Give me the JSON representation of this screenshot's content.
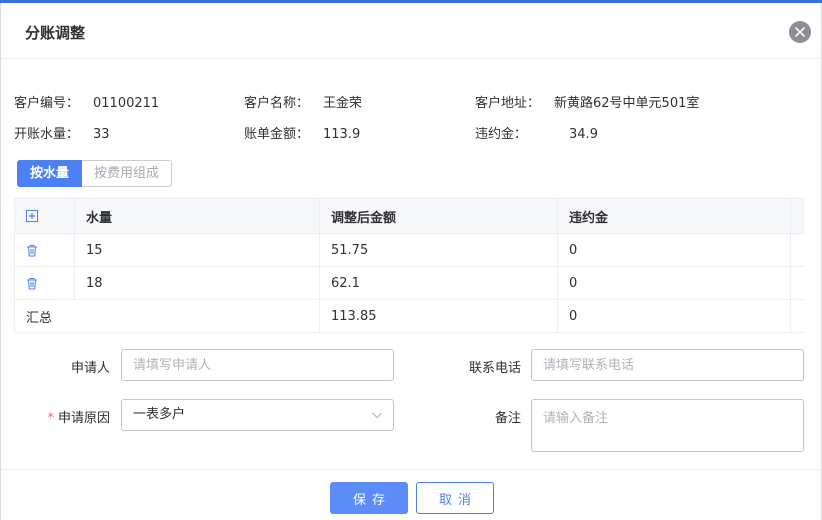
{
  "dialog": {
    "title": "分账调整"
  },
  "info": {
    "customer_no": {
      "label": "客户编号：",
      "value": "01100211"
    },
    "customer_name": {
      "label": "客户名称：",
      "value": "王金荣"
    },
    "customer_address": {
      "label": "客户地址：",
      "value": "新黄路62号中单元501室"
    },
    "billing_volume": {
      "label": "开账水量：",
      "value": "33"
    },
    "bill_amount": {
      "label": "账单金额：",
      "value": "113.9"
    },
    "penalty": {
      "label": "违约金：",
      "value": "34.9"
    }
  },
  "toggle": {
    "by_volume": "按水量",
    "by_fee": "按费用组成"
  },
  "table": {
    "headers": [
      "水量",
      "调整后金额",
      "违约金"
    ],
    "rows": [
      {
        "volume": "15",
        "amount": "51.75",
        "penalty": "0"
      },
      {
        "volume": "18",
        "amount": "62.1",
        "penalty": "0"
      }
    ],
    "summary": {
      "label": "汇总",
      "amount": "113.85",
      "penalty": "0"
    }
  },
  "form": {
    "applicant": {
      "label": "申请人",
      "placeholder": "请填写申请人",
      "value": ""
    },
    "phone": {
      "label": "联系电话",
      "placeholder": "请填写联系电话",
      "value": ""
    },
    "reason": {
      "label": "申请原因",
      "required_mark": "*",
      "value": "一表多户"
    },
    "remark": {
      "label": "备注",
      "placeholder": "请输入备注",
      "value": ""
    }
  },
  "footer": {
    "save_label": "保存",
    "cancel_label": "取消"
  },
  "icons": {
    "close": "close-icon",
    "add": "add-row-icon",
    "delete": "trash-icon",
    "dropdown": "chevron-down-icon"
  },
  "colors": {
    "primary": "#4d7ff5",
    "required": "#f56c6c"
  }
}
